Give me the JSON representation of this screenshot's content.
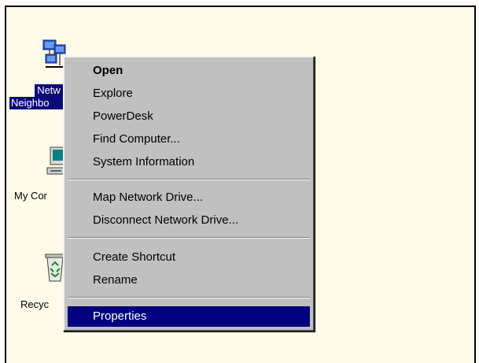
{
  "desktop": {
    "icons": [
      {
        "label": "Netw\nNeighbo",
        "line1": "Netw",
        "line2": "Neighbo",
        "selected": true,
        "icon": "network-neighborhood-icon"
      },
      {
        "label": "My Cor",
        "selected": false,
        "icon": "my-computer-icon"
      },
      {
        "label": "Recyc",
        "selected": false,
        "icon": "recycle-bin-icon"
      }
    ]
  },
  "context_menu": {
    "items": [
      {
        "label": "Open",
        "bold": true
      },
      {
        "label": "Explore"
      },
      {
        "label": "PowerDesk"
      },
      {
        "label": "Find Computer..."
      },
      {
        "label": "System Information"
      },
      {
        "label": "Map Network Drive..."
      },
      {
        "label": "Disconnect Network Drive..."
      },
      {
        "label": "Create Shortcut"
      },
      {
        "label": "Rename"
      },
      {
        "label": "Properties",
        "highlighted": true
      }
    ],
    "highlight_color": "#000080",
    "menu_color": "#c0c0c0"
  },
  "colors": {
    "desktop_background": "#fffbe9",
    "selection": "#0a0a78"
  }
}
